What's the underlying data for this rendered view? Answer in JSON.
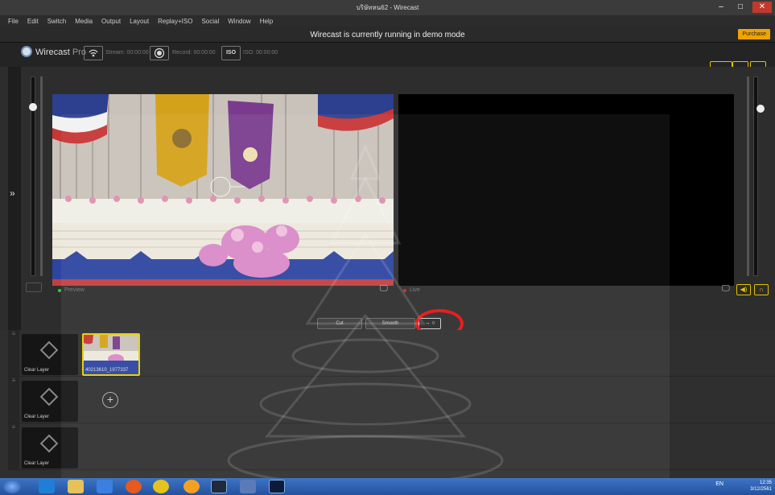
{
  "window": {
    "title": "บริษัทหน62 - Wirecast",
    "minimize": "–",
    "maximize": "□",
    "close": "✕"
  },
  "menu": [
    "File",
    "Edit",
    "Switch",
    "Media",
    "Output",
    "Layout",
    "Replay+ISO",
    "Social",
    "Window",
    "Help"
  ],
  "banner": {
    "message": "Wirecast is currently running in demo mode",
    "purchase": "Purchase"
  },
  "toolbar": {
    "brand": "Wirecast",
    "edition": "Pro",
    "stream_label": "Stream: 00:00:00",
    "record_label": "Record: 00:00:00",
    "iso_label": "ISO: 00:00:00",
    "iso_icon_text": "ISO"
  },
  "monitors": {
    "preview_label": "Preview",
    "live_label": "Live"
  },
  "transition": {
    "cut": "Cut",
    "smooth": "Smooth",
    "go": "→ ○"
  },
  "layers": [
    {
      "clear_label": "Clear Layer",
      "shot_label": "40213610_1977337"
    },
    {
      "clear_label": "Clear Layer",
      "add": "+"
    },
    {
      "clear_label": "Clear Layer"
    }
  ],
  "taskbar": {
    "lang": "EN",
    "time": "12:35",
    "date": "3/12/2561"
  },
  "colors": {
    "accent": "#e5c200",
    "highlight_ring": "#e81010",
    "purchase": "#f0a400",
    "taskbar": "#2d5fae"
  }
}
